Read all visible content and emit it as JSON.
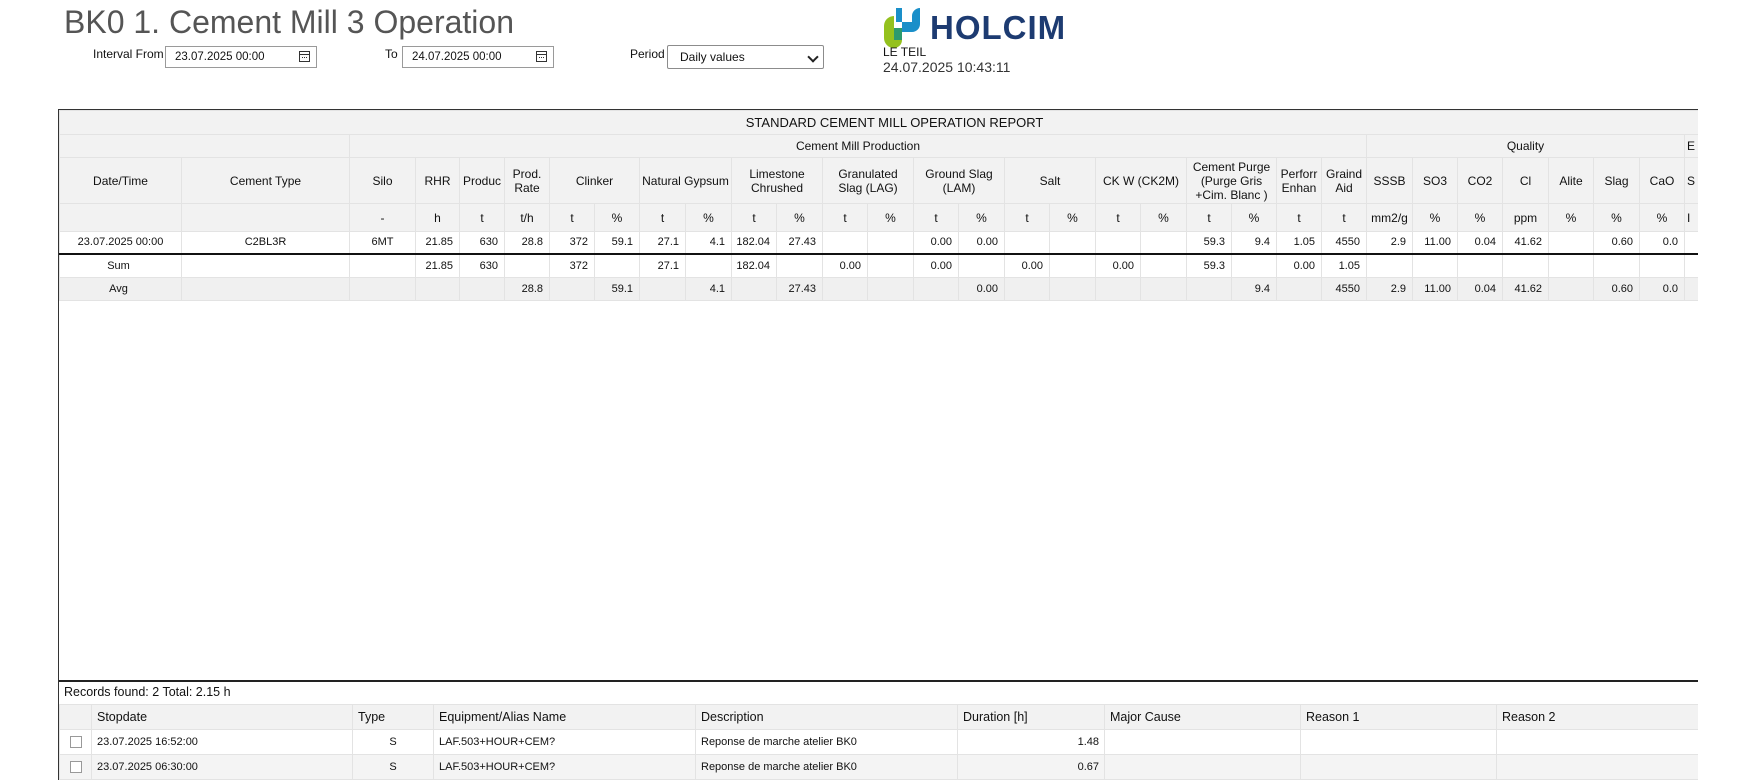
{
  "page_title": "BK0 1. Cement Mill 3 Operation",
  "filters": {
    "interval_from_label": "Interval From",
    "interval_from_value": "23.07.2025 00:00",
    "to_label": "To",
    "to_value": "24.07.2025 00:00",
    "period_label": "Period",
    "period_value": "Daily values"
  },
  "brand": {
    "name": "HOLCIM",
    "site": "LE TEIL",
    "timestamp": "24.07.2025 10:43:11",
    "colors": {
      "navy": "#1d3b71",
      "teal": "#1a8fc9",
      "green": "#94c11e"
    }
  },
  "report": {
    "title": "STANDARD CEMENT MILL OPERATION REPORT",
    "groups": {
      "production": "Cement Mill Production",
      "quality": "Quality",
      "next": "E"
    },
    "headers": {
      "datetime": "Date/Time",
      "cement_type": "Cement Type",
      "silo": "Silo",
      "rhr": "RHR",
      "produc": "Produc",
      "prod_rate": "Prod. Rate",
      "clinker": "Clinker",
      "gypsum": "Natural Gypsum",
      "limestone": "Limestone Chrushed",
      "lag": "Granulated Slag (LAG)",
      "lam": "Ground Slag (LAM)",
      "salt": "Salt",
      "ckw": "CK W (CK2M)",
      "purge": "Cement Purge (Purge Gris +Cim. Blanc )",
      "perf": "Perforr Enhan",
      "grind": "Graind Aid",
      "sssb": "SSSB",
      "so3": "SO3",
      "co2": "CO2",
      "cl": "Cl",
      "alite": "Alite",
      "slag": "Slag",
      "cao": "CaO",
      "more": "S"
    },
    "units": {
      "silo": "-",
      "rhr": "h",
      "produc": "t",
      "prod_rate": "t/h",
      "clinker_t": "t",
      "clinker_p": "%",
      "gypsum_t": "t",
      "gypsum_p": "%",
      "limestone_t": "t",
      "limestone_p": "%",
      "lag_t": "t",
      "lag_p": "%",
      "lam_t": "t",
      "lam_p": "%",
      "salt_t": "t",
      "salt_p": "%",
      "ckw_t": "t",
      "ckw_p": "%",
      "purge_t": "t",
      "purge_p": "%",
      "perf": "t",
      "grind": "t",
      "sssb": "mm2/g",
      "so3": "%",
      "co2": "%",
      "cl": "ppm",
      "alite": "%",
      "slag": "%",
      "cao": "%",
      "more": "I"
    },
    "row": {
      "datetime": "23.07.2025 00:00",
      "cement_type": "C2BL3R",
      "silo": "6MT",
      "rhr": "21.85",
      "produc": "630",
      "prod_rate": "28.8",
      "clinker_t": "372",
      "clinker_p": "59.1",
      "gypsum_t": "27.1",
      "gypsum_p": "4.1",
      "limestone_t": "182.04",
      "limestone_p": "27.43",
      "lam_t": "0.00",
      "lam_p": "0.00",
      "purge_t": "59.3",
      "purge_p": "9.4",
      "perf": "1.05",
      "grind": "4550",
      "sssb": "2.9",
      "so3": "11.00",
      "co2": "0.04",
      "cl": "41.62",
      "slag": "0.60",
      "cao": "0.0"
    },
    "sum": {
      "label": "Sum",
      "rhr": "21.85",
      "produc": "630",
      "clinker_t": "372",
      "gypsum_t": "27.1",
      "limestone_t": "182.04",
      "lag_t": "0.00",
      "lam_t": "0.00",
      "salt_t": "0.00",
      "ckw_t": "0.00",
      "purge_t": "59.3",
      "perf": "0.00",
      "grind": "1.05"
    },
    "avg": {
      "label": "Avg",
      "prod_rate": "28.8",
      "clinker_p": "59.1",
      "gypsum_p": "4.1",
      "limestone_p": "27.43",
      "lam_p": "0.00",
      "purge_p": "9.4",
      "grind": "4550",
      "sssb": "2.9",
      "so3": "11.00",
      "co2": "0.04",
      "cl": "41.62",
      "slag": "0.60",
      "cao": "0.0"
    }
  },
  "stops": {
    "records_text": "Records found:  2 Total: 2.15 h",
    "columns": [
      "Stopdate",
      "Type",
      "Equipment/Alias Name",
      "Description",
      "Duration [h]",
      "Major Cause",
      "Reason 1",
      "Reason 2"
    ],
    "rows": [
      {
        "stopdate": "23.07.2025 16:52:00",
        "type": "S",
        "equipment": "LAF.503+HOUR+CEM?",
        "description": "Reponse de marche atelier BK0",
        "duration": "1.48",
        "major_cause": "",
        "reason1": "",
        "reason2": ""
      },
      {
        "stopdate": "23.07.2025 06:30:00",
        "type": "S",
        "equipment": "LAF.503+HOUR+CEM?",
        "description": "Reponse de marche atelier BK0",
        "duration": "0.67",
        "major_cause": "",
        "reason1": "",
        "reason2": ""
      }
    ]
  }
}
